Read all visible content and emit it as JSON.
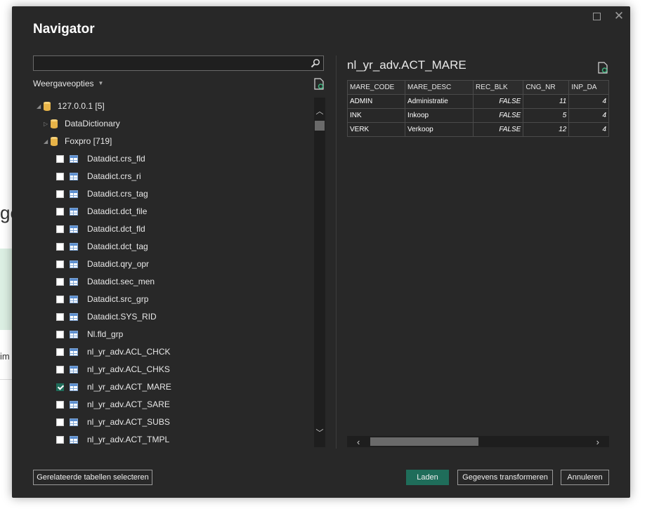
{
  "background": {
    "partial_text_1": "ge",
    "partial_text_2": "im"
  },
  "dialog": {
    "title": "Navigator",
    "search": {
      "value": "",
      "placeholder": ""
    },
    "display_options_label": "Weergaveopties",
    "tree": {
      "server": {
        "label": "127.0.0.1 [5]",
        "expanded": true
      },
      "databases": [
        {
          "label": "DataDictionary",
          "expanded": false
        },
        {
          "label": "Foxpro [719]",
          "expanded": true
        }
      ],
      "tables": [
        {
          "label": "Datadict.crs_fld",
          "checked": false
        },
        {
          "label": "Datadict.crs_ri",
          "checked": false
        },
        {
          "label": "Datadict.crs_tag",
          "checked": false
        },
        {
          "label": "Datadict.dct_file",
          "checked": false
        },
        {
          "label": "Datadict.dct_fld",
          "checked": false
        },
        {
          "label": "Datadict.dct_tag",
          "checked": false
        },
        {
          "label": "Datadict.qry_opr",
          "checked": false
        },
        {
          "label": "Datadict.sec_men",
          "checked": false
        },
        {
          "label": "Datadict.src_grp",
          "checked": false
        },
        {
          "label": "Datadict.SYS_RID",
          "checked": false
        },
        {
          "label": "Nl.fld_grp",
          "checked": false
        },
        {
          "label": "nl_yr_adv.ACL_CHCK",
          "checked": false
        },
        {
          "label": "nl_yr_adv.ACL_CHKS",
          "checked": false
        },
        {
          "label": "nl_yr_adv.ACT_MARE",
          "checked": true
        },
        {
          "label": "nl_yr_adv.ACT_SARE",
          "checked": false
        },
        {
          "label": "nl_yr_adv.ACT_SUBS",
          "checked": false
        },
        {
          "label": "nl_yr_adv.ACT_TMPL",
          "checked": false
        }
      ]
    },
    "preview": {
      "title": "nl_yr_adv.ACT_MARE",
      "columns": [
        "MARE_CODE",
        "MARE_DESC",
        "REC_BLK",
        "CNG_NR",
        "INP_DA"
      ],
      "rows": [
        [
          "ADMIN",
          "Administratie",
          "FALSE",
          "11",
          "4"
        ],
        [
          "INK",
          "Inkoop",
          "FALSE",
          "5",
          "4"
        ],
        [
          "VERK",
          "Verkoop",
          "FALSE",
          "12",
          "4"
        ]
      ]
    },
    "buttons": {
      "related": "Gerelateerde tabellen selecteren",
      "load": "Laden",
      "transform": "Gegevens transformeren",
      "cancel": "Annuleren"
    },
    "colors": {
      "accent": "#1f6d5a",
      "background": "#282828",
      "table_icon": "#5b8ed0",
      "db_icon": "#e8b448"
    }
  }
}
